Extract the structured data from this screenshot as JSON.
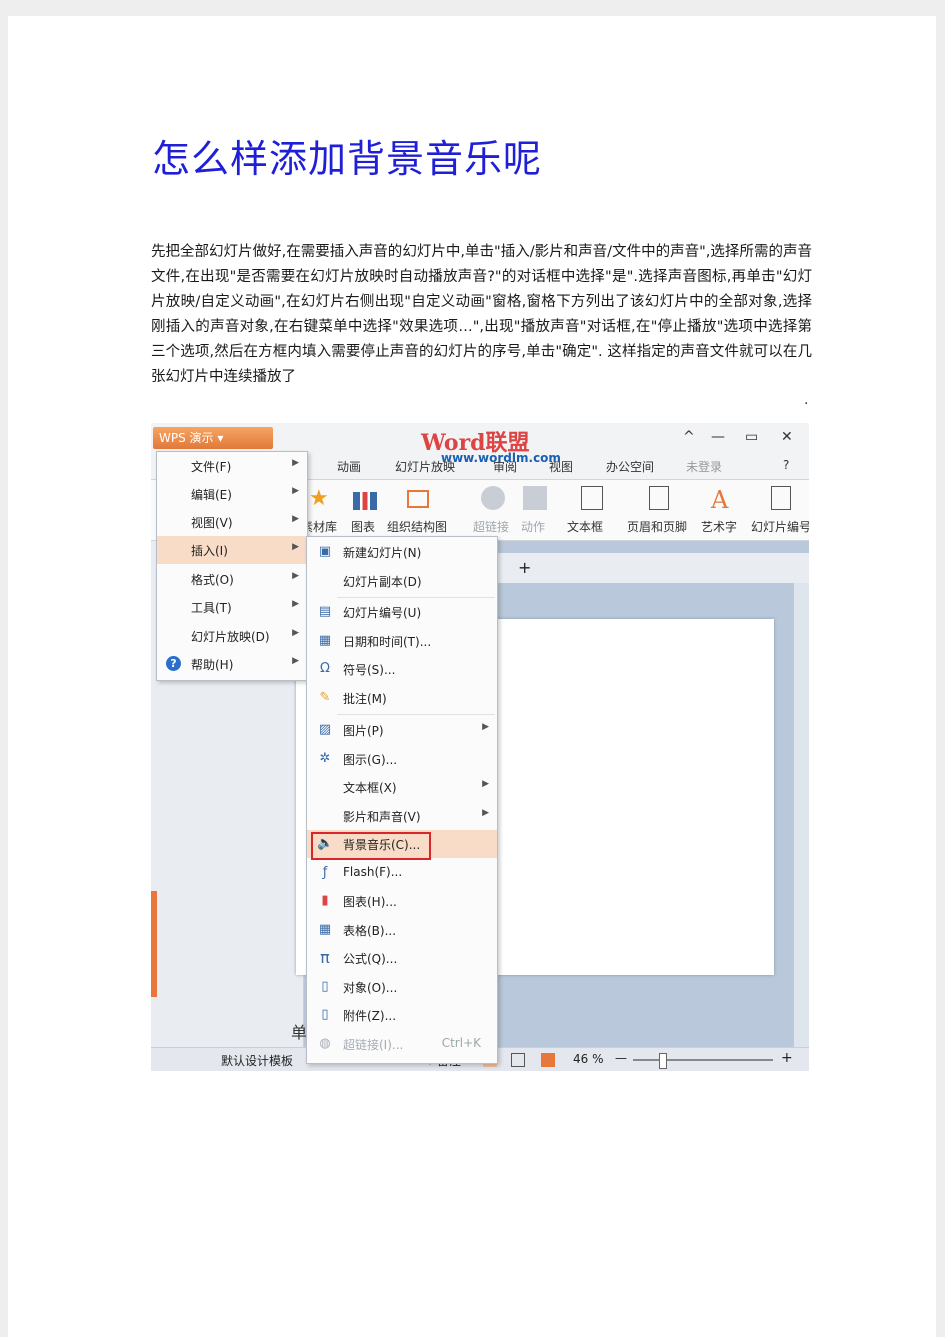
{
  "title": "怎么样添加背景音乐呢",
  "paragraph": "先把全部幻灯片做好,在需要插入声音的幻灯片中,单击\"插入/影片和声音/文件中的声音\",选择所需的声音文件,在出现\"是否需要在幻灯片放映时自动播放声音?\"的对话框中选择\"是\".选择声音图标,再单击\"幻灯片放映/自定义动画\",在幻灯片右侧出现\"自定义动画\"窗格,窗格下方列出了该幻灯片中的全部对象,选择刚插入的声音对象,在右键菜单中选择\"效果选项…\",出现\"播放声音\"对话框,在\"停止播放\"选项中选择第三个选项,然后在方框内填入需要停止声音的幻灯片的序号,单击\"确定\". 这样指定的声音文件就可以在几张幻灯片中连续播放了",
  "paragraph_end": ".",
  "screenshot": {
    "app_button": "WPS 演示",
    "watermark": "Word联盟",
    "watermark_url": "www.wordlm.com",
    "win_controls": [
      "^",
      "—",
      "▭",
      "✕"
    ],
    "tabs": [
      "动画",
      "幻灯片放映",
      "审阅",
      "视图",
      "办公空间",
      "未登录",
      "?"
    ],
    "ribbon": [
      "素材库",
      "图表",
      "组织结构图",
      "超链接",
      "动作",
      "文本框",
      "页眉和页脚",
      "艺术字",
      "幻灯片编号"
    ],
    "menu_main": [
      {
        "label": "文件(F)",
        "arrow": true
      },
      {
        "label": "编辑(E)",
        "arrow": true
      },
      {
        "label": "视图(V)",
        "arrow": true
      },
      {
        "label": "插入(I)",
        "arrow": true,
        "active": true
      },
      {
        "label": "格式(O)",
        "arrow": true
      },
      {
        "label": "工具(T)",
        "arrow": true
      },
      {
        "label": "幻灯片放映(D)",
        "arrow": true
      },
      {
        "label": "帮助(H)",
        "arrow": true
      }
    ],
    "menu_insert": [
      {
        "label": "新建幻灯片(N)",
        "icon": "slide-icon"
      },
      {
        "label": "幻灯片副本(D)",
        "icon": ""
      },
      {
        "label": "幻灯片编号(U)",
        "icon": "number-icon"
      },
      {
        "label": "日期和时间(T)...",
        "icon": "calendar-icon"
      },
      {
        "label": "符号(S)...",
        "icon": "omega-icon"
      },
      {
        "label": "批注(M)",
        "icon": "comment-icon"
      },
      {
        "label": "图片(P)",
        "icon": "picture-icon",
        "arrow": true
      },
      {
        "label": "图示(G)...",
        "icon": "diagram-icon"
      },
      {
        "label": "文本框(X)",
        "icon": "",
        "arrow": true
      },
      {
        "label": "影片和声音(V)",
        "icon": "",
        "arrow": true
      },
      {
        "label": "背景音乐(C)...",
        "icon": "speaker-icon",
        "highlighted": true
      },
      {
        "label": "Flash(F)...",
        "icon": "flash-icon"
      },
      {
        "label": "图表(H)...",
        "icon": "chart-icon"
      },
      {
        "label": "表格(B)...",
        "icon": "table-icon"
      },
      {
        "label": "公式(Q)...",
        "icon": "pi-icon"
      },
      {
        "label": "对象(O)...",
        "icon": "object-icon"
      },
      {
        "label": "附件(Z)...",
        "icon": "attachment-icon"
      },
      {
        "label": "超链接(I)...",
        "icon": "link-icon",
        "shortcut": "Ctrl+K",
        "disabled": true
      }
    ],
    "status_template": "默认设计模板",
    "status_notes": "备注",
    "zoom": "46 %",
    "pane_label": "单"
  }
}
